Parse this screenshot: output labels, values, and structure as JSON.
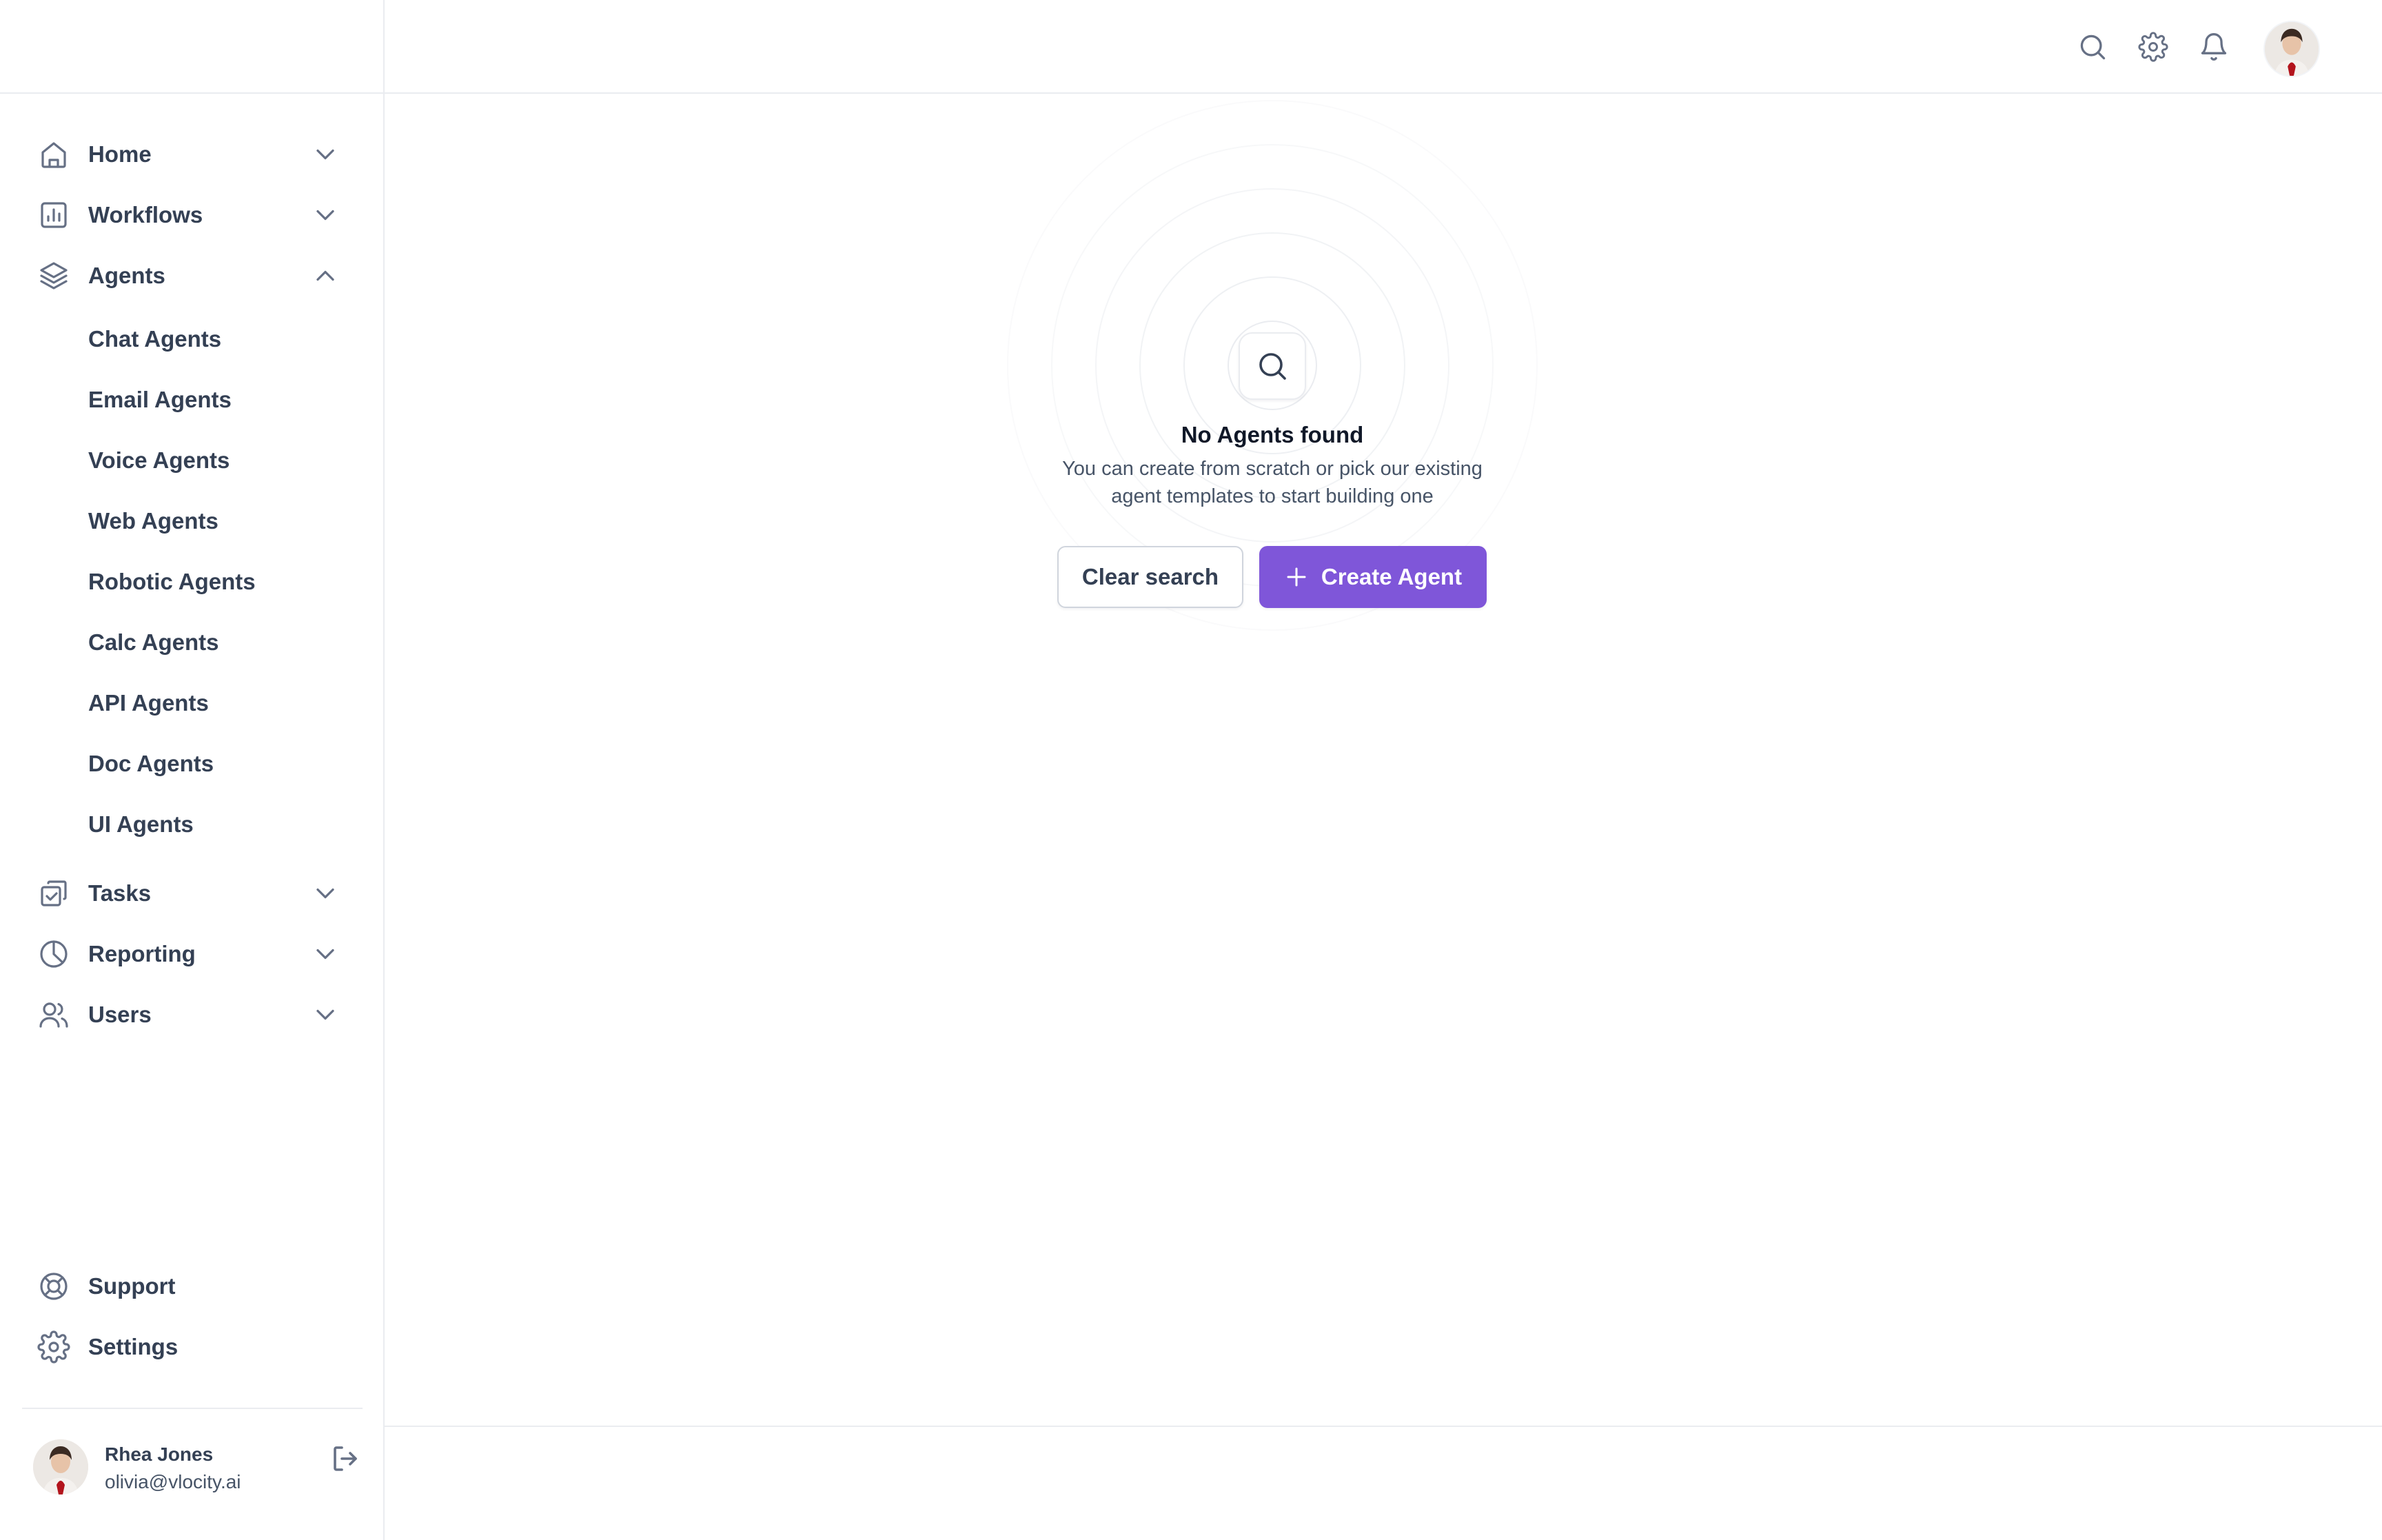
{
  "sidebar": {
    "nav": {
      "home": "Home",
      "workflows": "Workflows",
      "agents": "Agents",
      "tasks": "Tasks",
      "reporting": "Reporting",
      "users": "Users"
    },
    "agent_subitems": [
      "Chat Agents",
      "Email Agents",
      "Voice Agents",
      "Web Agents",
      "Robotic Agents",
      "Calc Agents",
      "API Agents",
      "Doc Agents",
      "UI Agents"
    ],
    "bottom": {
      "support": "Support",
      "settings": "Settings"
    },
    "user": {
      "name": "Rhea Jones",
      "email": "olivia@vlocity.ai"
    }
  },
  "header": {
    "icons": [
      "search-icon",
      "gear-icon",
      "bell-icon",
      "avatar"
    ]
  },
  "empty_state": {
    "title": "No Agents found",
    "description_line1": "You can create from scratch or pick our existing",
    "description_line2": "agent templates to start building one",
    "clear_button": "Clear search",
    "create_button": "Create Agent"
  },
  "colors": {
    "accent": "#7f56d9",
    "text": "#344054",
    "border": "#eaecf0"
  }
}
